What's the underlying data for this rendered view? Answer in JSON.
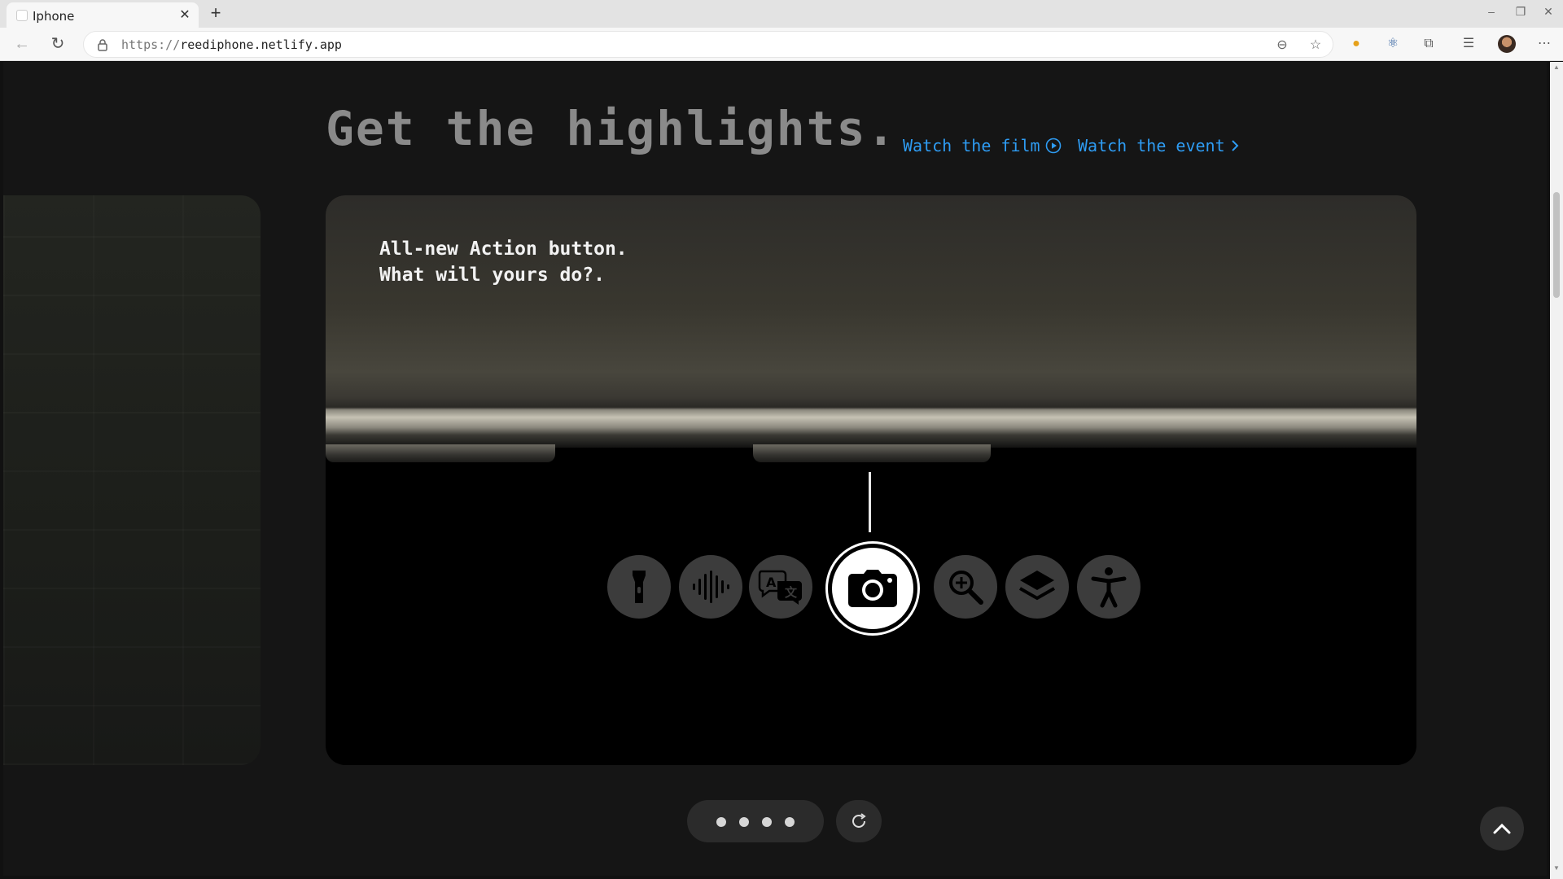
{
  "browser": {
    "tab_title": "Iphone",
    "close_tab": "✕",
    "new_tab": "+",
    "url_scheme": "https://",
    "url_host": "reediphone.netlify.app"
  },
  "page": {
    "heading": "Get the highlights.",
    "watch_film": "Watch the film",
    "watch_event": "Watch the event",
    "card_text": "All-new Action button.\nWhat will yours do?.",
    "carousel_dots": 4,
    "action_icons": [
      "flashlight-icon",
      "voice-memo-icon",
      "translate-icon",
      "camera-icon",
      "magnifier-icon",
      "focus-layers-icon",
      "accessibility-icon"
    ],
    "active_action": "camera-icon"
  },
  "colors": {
    "link": "#2e9cf3",
    "heading": "#8a8a8a",
    "background": "#151515"
  }
}
